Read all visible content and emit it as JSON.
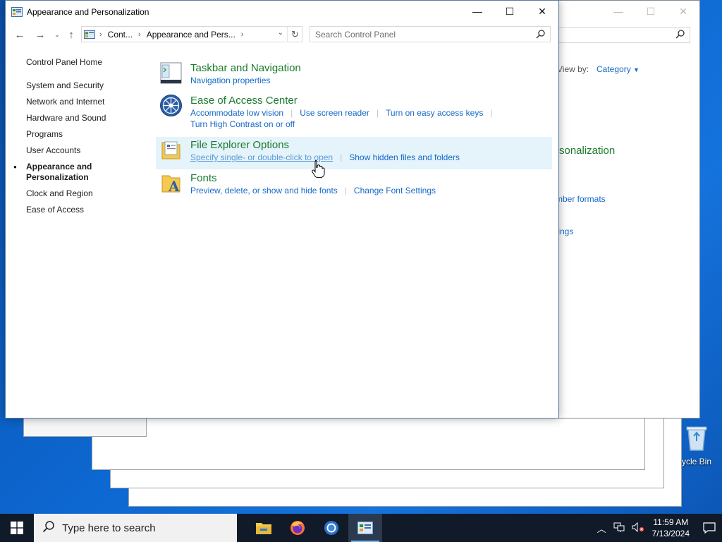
{
  "window": {
    "title": "Appearance and Personalization",
    "minimize": "—",
    "maximize": "☐",
    "close": "✕"
  },
  "address": {
    "crumb1": "Cont...",
    "crumb2": "Appearance and Pers...",
    "chevron": "›"
  },
  "search": {
    "placeholder": "Search Control Panel"
  },
  "leftnav": {
    "home": "Control Panel Home",
    "items": [
      {
        "label": "System and Security"
      },
      {
        "label": "Network and Internet"
      },
      {
        "label": "Hardware and Sound"
      },
      {
        "label": "Programs"
      },
      {
        "label": "User Accounts"
      },
      {
        "label": "Appearance and Personalization",
        "line1": "Appearance and",
        "line2": "Personalization",
        "active": true
      },
      {
        "label": "Clock and Region"
      },
      {
        "label": "Ease of Access"
      }
    ]
  },
  "categories": [
    {
      "title": "Taskbar and Navigation",
      "links": [
        "Navigation properties"
      ]
    },
    {
      "title": "Ease of Access Center",
      "links": [
        "Accommodate low vision",
        "Use screen reader",
        "Turn on easy access keys",
        "Turn High Contrast on or off"
      ]
    },
    {
      "title": "File Explorer Options",
      "links": [
        "Specify single- or double-click to open",
        "Show hidden files and folders"
      ]
    },
    {
      "title": "Fonts",
      "links": [
        "Preview, delete, or show and hide fonts",
        "Change Font Settings"
      ]
    }
  ],
  "background_window": {
    "view_by": "View by:",
    "category": "Category",
    "personalization_fragment": "rsonalization",
    "number_formats_fragment": "mber formats",
    "settings_fragment": "tings"
  },
  "desktop": {
    "recycle_bin_label": "ycle Bin"
  },
  "taskbar": {
    "search_placeholder": "Type here to search",
    "time": "11:59 AM",
    "date": "7/13/2024"
  },
  "colors": {
    "category_title": "#1a7a2c",
    "link": "#1569c7",
    "highlight": "#e5f3fb",
    "taskbar": "#101a28"
  }
}
